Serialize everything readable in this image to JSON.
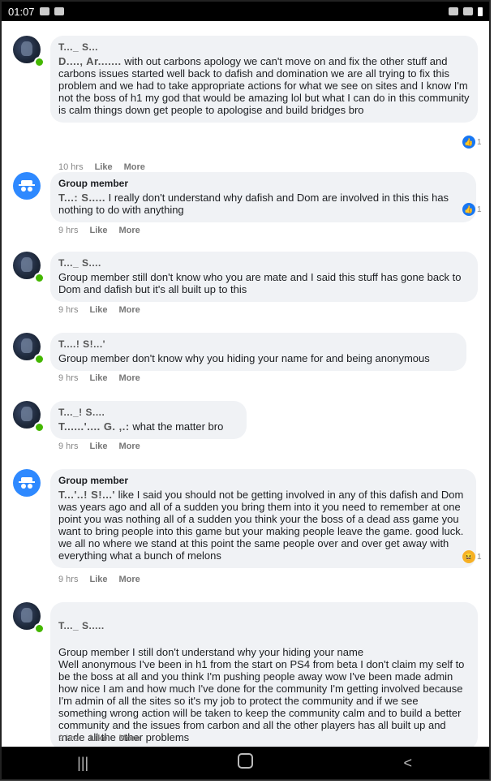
{
  "status_bar": {
    "time": "01:07"
  },
  "comments": [
    {
      "avatar": "profile-photo",
      "author": "T..._ S...",
      "mention": "D...., Ar.......",
      "text": " with out carbons apology we can't move on and fix the other stuff and carbons issues started well back to dafish and domination we are all trying to fix this problem and we had to take appropriate actions for what we see on sites and I know I'm not the boss of h1 my god that would be amazing lol but what I can do in this community is calm things down get people to apologise and build bridges bro",
      "time": "10 hrs",
      "like": "Like",
      "more": "More",
      "reaction": {
        "type": "like",
        "count": "1"
      }
    },
    {
      "avatar": "anonymous",
      "author": "Group member",
      "mention": "T...: S.....",
      "text": " I really don't understand why dafish and Dom are involved in this this has nothing to do with anything",
      "time": "9 hrs",
      "like": "Like",
      "more": "More",
      "reaction": {
        "type": "like",
        "count": "1"
      }
    },
    {
      "avatar": "profile-photo",
      "author": "T..._ S....",
      "mention": "",
      "text": "Group member still don't know who you are mate and I said this stuff has gone back to Dom and dafish but it's all built up to this",
      "time": "9 hrs",
      "like": "Like",
      "more": "More"
    },
    {
      "avatar": "profile-photo",
      "author": "T....! S!...'",
      "mention": "",
      "text": "Group member don't know why you hiding your name for and being anonymous",
      "time": "9 hrs",
      "like": "Like",
      "more": "More"
    },
    {
      "avatar": "profile-photo",
      "author": "T..._! S....",
      "mention": "T......'.... G. ,.:",
      "text": " what the matter bro",
      "time": "9 hrs",
      "like": "Like",
      "more": "More"
    },
    {
      "avatar": "anonymous",
      "author": "Group member",
      "mention": "T...'..! S!...'",
      "text": " like I said you should not be getting involved in any of this dafish and Dom was years ago and all of a sudden you bring them into it you need to remember at one point you was nothing all of a sudden you think your the boss of a dead ass game you want to bring people into this game but your making people leave the game. good luck. we all no where we stand at this point the same people over and over get away with everything what a bunch of melons",
      "time": "9 hrs",
      "like": "Like",
      "more": "More",
      "reaction": {
        "type": "haha",
        "count": "1"
      }
    },
    {
      "avatar": "profile-photo",
      "author": "T..._ S.....",
      "mention": "",
      "text": "Group member I still don't understand why your hiding your name\nWell anonymous I've been in h1 from the start on PS4 from beta I don't claim my self to be the boss at all and you think I'm pushing people away wow I've been made admin how nice I am and how much I've done for the community I'm getting involved because I'm admin of all the sites so it's my job to protect the community and if we see something wrong action will be taken to keep the community calm and to build a better community and the issues from carbon and all the other players has all built up and made all the other problems",
      "time": "9 hrs",
      "like": "Like",
      "more": "More"
    }
  ],
  "nav": {
    "recent": "|||",
    "home": "",
    "back": "<"
  },
  "colors": {
    "bubble": "#f0f2f5",
    "like_blue": "#1877f2",
    "online_green": "#44b700",
    "anon_blue": "#2e89ff"
  }
}
